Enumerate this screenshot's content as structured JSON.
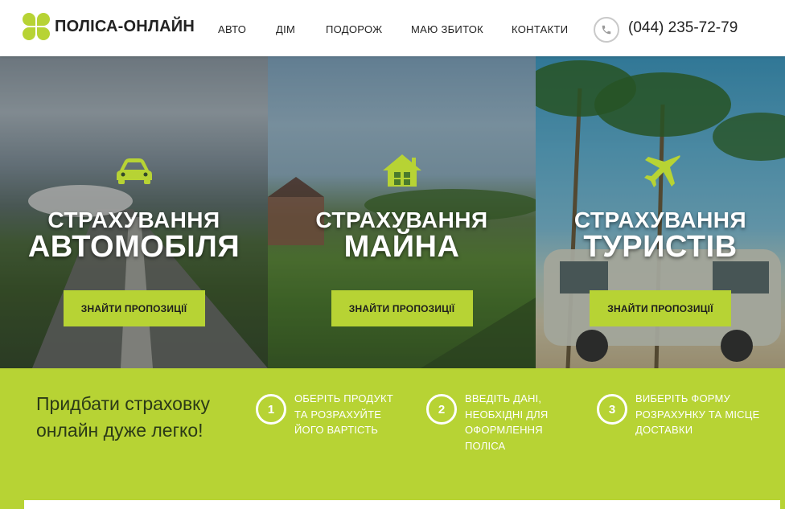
{
  "header": {
    "logo_text": "ПОЛІСА-ОНЛАЙН",
    "nav": [
      {
        "label": "АВТО"
      },
      {
        "label": "ДІМ"
      },
      {
        "label": "ПОДОРОЖ"
      },
      {
        "label": "МАЮ ЗБИТОК"
      },
      {
        "label": "КОНТАКТИ"
      }
    ],
    "phone_icon": "phone-icon",
    "phone": "(044) 235-72-79"
  },
  "panels": [
    {
      "icon": "car-icon",
      "title_line1": "СТРАХУВАННЯ",
      "title_line2": "АВТОМОБІЛЯ",
      "button": "ЗНАЙТИ ПРОПОЗИЦІЇ"
    },
    {
      "icon": "house-icon",
      "title_line1": "СТРАХУВАННЯ",
      "title_line2": "МАЙНА",
      "button": "ЗНАЙТИ ПРОПОЗИЦІЇ"
    },
    {
      "icon": "airplane-icon",
      "title_line1": "СТРАХУВАННЯ",
      "title_line2": "ТУРИСТІВ",
      "button": "ЗНАЙТИ ПРОПОЗИЦІЇ"
    }
  ],
  "steps_section": {
    "title": "Придбати страховку онлайн дуже легко!",
    "steps": [
      {
        "number": "1",
        "text": "ОБЕРІТЬ ПРОДУКТ ТА РОЗРАХУЙТЕ ЙОГО ВАРТІСТЬ"
      },
      {
        "number": "2",
        "text": "ВВЕДІТЬ ДАНІ, НЕОБХІДНІ ДЛЯ ОФОРМЛЕННЯ ПОЛІСА"
      },
      {
        "number": "3",
        "text": "ВИБЕРІТЬ ФОРМУ РОЗРАХУНКУ ТА МІСЦЕ ДОСТАВКИ"
      }
    ]
  },
  "colors": {
    "accent": "#b7d334",
    "text_dark": "#222222",
    "white": "#ffffff"
  }
}
